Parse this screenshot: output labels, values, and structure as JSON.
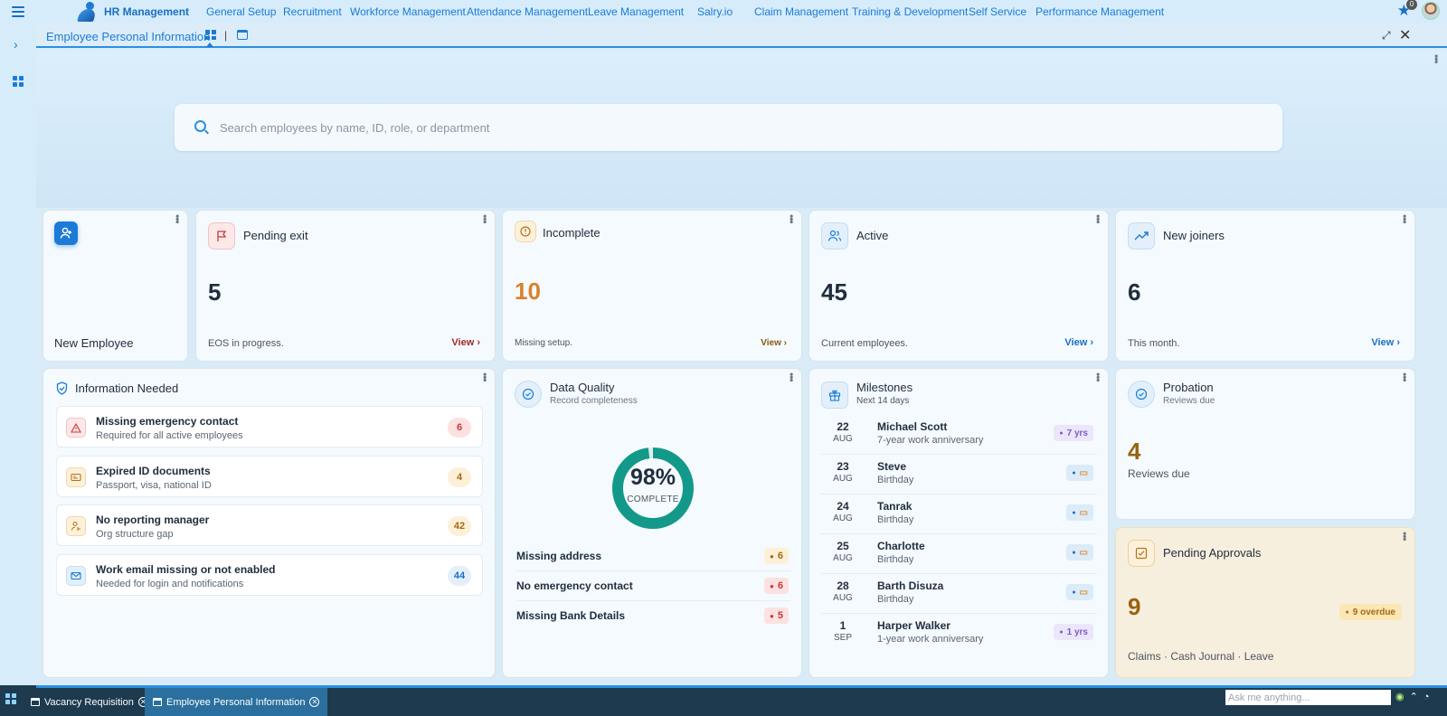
{
  "nav": {
    "brand": "HR Management",
    "items": [
      "General Setup",
      "Recruitment",
      "Workforce Management",
      "Attendance Management",
      "Leave Management",
      "Salry.io",
      "Claim Management",
      "Training & Development",
      "Self Service",
      "Performance Management"
    ],
    "favorites_count": "0"
  },
  "breadcrumb": {
    "title": "Employee Personal Information",
    "separator": "|"
  },
  "search": {
    "placeholder": "Search employees by name, ID, role, or department"
  },
  "stats": {
    "new_employee": "New Employee",
    "pending_exit": {
      "title": "Pending exit",
      "value": "5",
      "desc": "EOS in progress.",
      "link": "View ›"
    },
    "incomplete": {
      "title": "Incomplete",
      "value": "10",
      "desc": "Missing setup.",
      "link": "View ›"
    },
    "active": {
      "title": "Active",
      "value": "45",
      "desc": "Current employees.",
      "link": "View ›"
    },
    "new_joiners": {
      "title": "New joiners",
      "value": "6",
      "desc": "This month.",
      "link": "View ›"
    }
  },
  "info_needed": {
    "title": "Information Needed",
    "items": [
      {
        "title": "Missing emergency contact",
        "sub": "Required for all active employees",
        "count": "6"
      },
      {
        "title": "Expired ID documents",
        "sub": "Passport, visa, national ID",
        "count": "4"
      },
      {
        "title": "No reporting manager",
        "sub": "Org structure gap",
        "count": "42"
      },
      {
        "title": "Work email missing or not enabled",
        "sub": "Needed for login and notifications",
        "count": "44"
      }
    ]
  },
  "data_quality": {
    "title": "Data Quality",
    "subtitle": "Record completeness",
    "percent_label": "98%",
    "percent_value": 98,
    "complete_label": "COMPLETE",
    "rows": [
      {
        "label": "Missing address",
        "count": "6"
      },
      {
        "label": "No emergency contact",
        "count": "6"
      },
      {
        "label": "Missing Bank Details",
        "count": "5"
      }
    ]
  },
  "milestones": {
    "title": "Milestones",
    "subtitle": "Next 14 days",
    "items": [
      {
        "day": "22",
        "month": "AUG",
        "name": "Michael Scott",
        "desc": "7-year work anniversary",
        "tag": "7 yrs"
      },
      {
        "day": "23",
        "month": "AUG",
        "name": "Steve",
        "desc": "Birthday",
        "tag": ""
      },
      {
        "day": "24",
        "month": "AUG",
        "name": "Tanrak",
        "desc": "Birthday",
        "tag": ""
      },
      {
        "day": "25",
        "month": "AUG",
        "name": "Charlotte",
        "desc": "Birthday",
        "tag": ""
      },
      {
        "day": "28",
        "month": "AUG",
        "name": "Barth Disuza",
        "desc": "Birthday",
        "tag": ""
      },
      {
        "day": "1",
        "month": "SEP",
        "name": "Harper Walker",
        "desc": "1-year work anniversary",
        "tag": "1 yrs"
      }
    ]
  },
  "probation": {
    "title": "Probation",
    "subtitle": "Reviews due",
    "value": "4",
    "desc": "Reviews due"
  },
  "approvals": {
    "title": "Pending Approvals",
    "value": "9",
    "overdue": "9 overdue",
    "desc": "Claims · Cash Journal · Leave"
  },
  "taskbar": {
    "tabs": [
      "Vacancy Requisition",
      "Employee Personal Information"
    ],
    "ask_placeholder": "Ask me anything..."
  },
  "colors": {
    "accent": "#1b7bd6",
    "orange": "#d9822b",
    "danger": "#c43b3b",
    "teal": "#13998a",
    "purple": "#7c5cc4"
  }
}
